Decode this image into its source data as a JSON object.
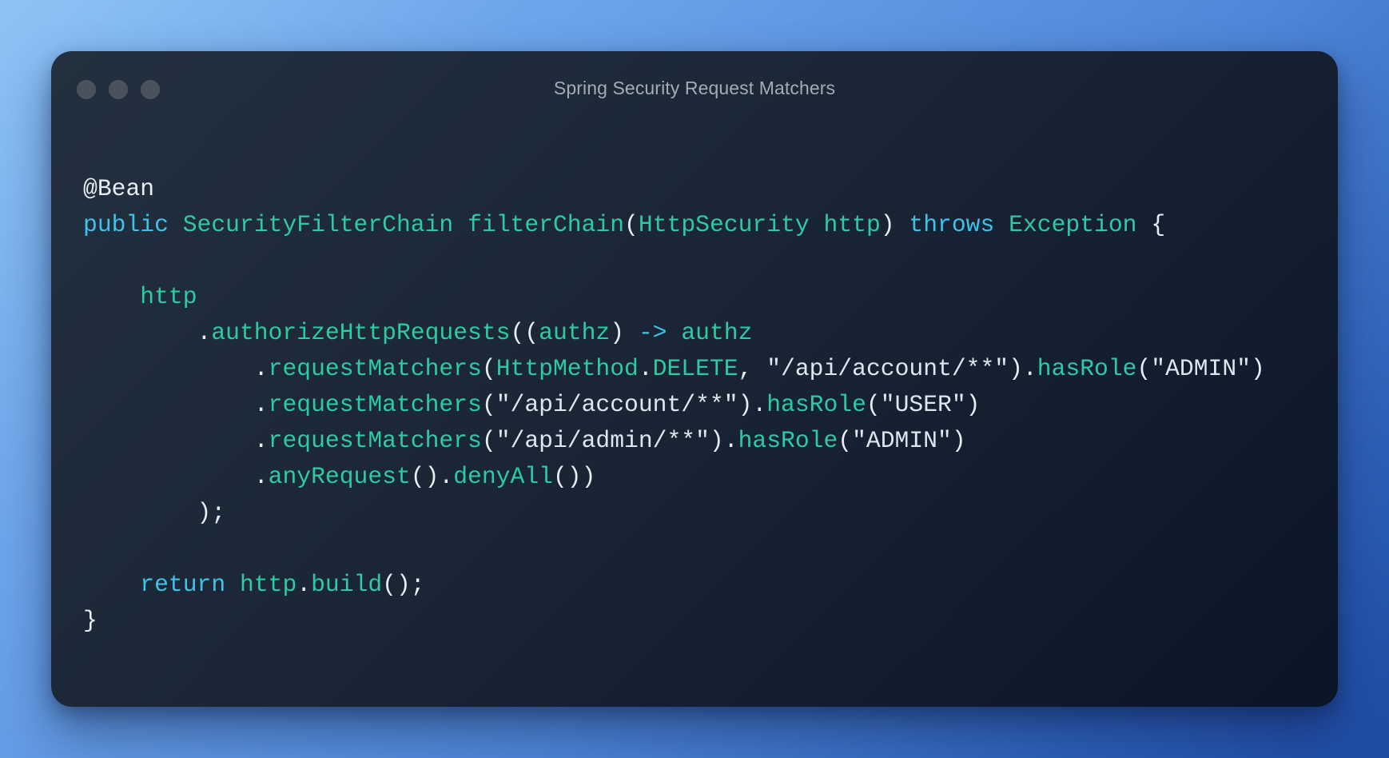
{
  "window": {
    "title": "Spring Security Request Matchers",
    "controls": [
      "close",
      "minimize",
      "maximize"
    ]
  },
  "colors": {
    "keyword": "#3fc2ea",
    "identifier": "#2ec9a5",
    "plain": "#e6edf3",
    "title": "#a3acb6",
    "control_dot": "#4a535d"
  },
  "code": {
    "lines": [
      "@Bean",
      "public SecurityFilterChain filterChain(HttpSecurity http) throws Exception {",
      "",
      "    http",
      "        .authorizeHttpRequests((authz) -> authz",
      "            .requestMatchers(HttpMethod.DELETE, \"/api/account/**\").hasRole(\"ADMIN\")",
      "            .requestMatchers(\"/api/account/**\").hasRole(\"USER\")",
      "            .requestMatchers(\"/api/admin/**\").hasRole(\"ADMIN\")",
      "            .anyRequest().denyAll())",
      "        );",
      "",
      "    return http.build();",
      "}"
    ]
  }
}
